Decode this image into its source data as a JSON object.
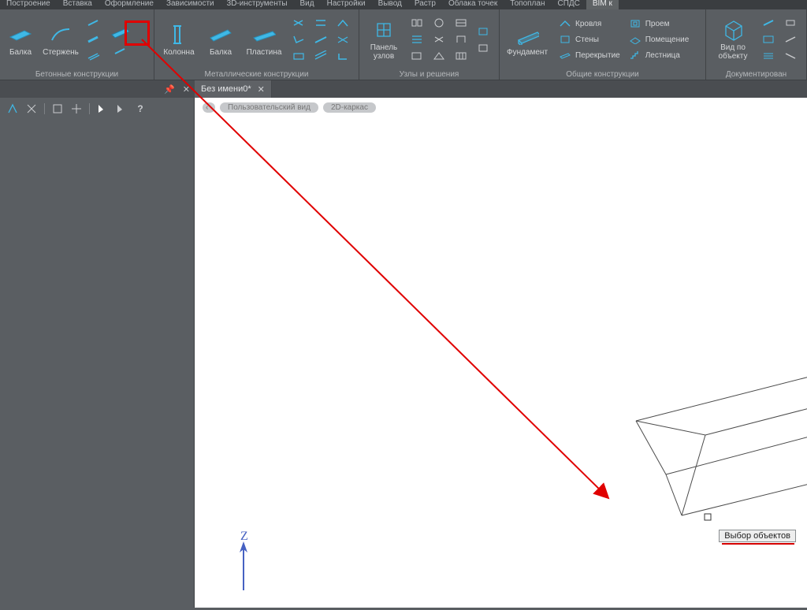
{
  "topTabs": {
    "items": [
      "Построение",
      "Вставка",
      "Оформление",
      "Зависимости",
      "3D-инструменты",
      "Вид",
      "Настройки",
      "Вывод",
      "Растр",
      "Облака точек",
      "Топоплан",
      "СПДС",
      "BIM к"
    ]
  },
  "ribbon": {
    "panels": {
      "concrete": {
        "title": "Бетонные конструкции",
        "beam": "Балка",
        "rod": "Стержень"
      },
      "metal": {
        "title": "Металлические конструкции",
        "column": "Колонна",
        "beam": "Балка",
        "plate": "Пластина"
      },
      "nodes": {
        "title": "Узлы и решения",
        "panelNodes": "Панель\nузлов"
      },
      "general": {
        "title": "Общие конструкции",
        "foundation": "Фундамент",
        "roof": "Кровля",
        "walls": "Стены",
        "slab": "Перекрытие",
        "opening": "Проем",
        "room": "Помещение",
        "stair": "Лестница"
      },
      "doc": {
        "title": "Документирован",
        "viewByObject": "Вид по\nобъекту"
      }
    }
  },
  "docTabs": {
    "name": "Без имени0*"
  },
  "chips": {
    "userView": "Пользовательский вид",
    "wire": "2D-каркас"
  },
  "compass": {
    "label": "Z"
  },
  "tooltip": {
    "text": "Выбор объектов"
  }
}
